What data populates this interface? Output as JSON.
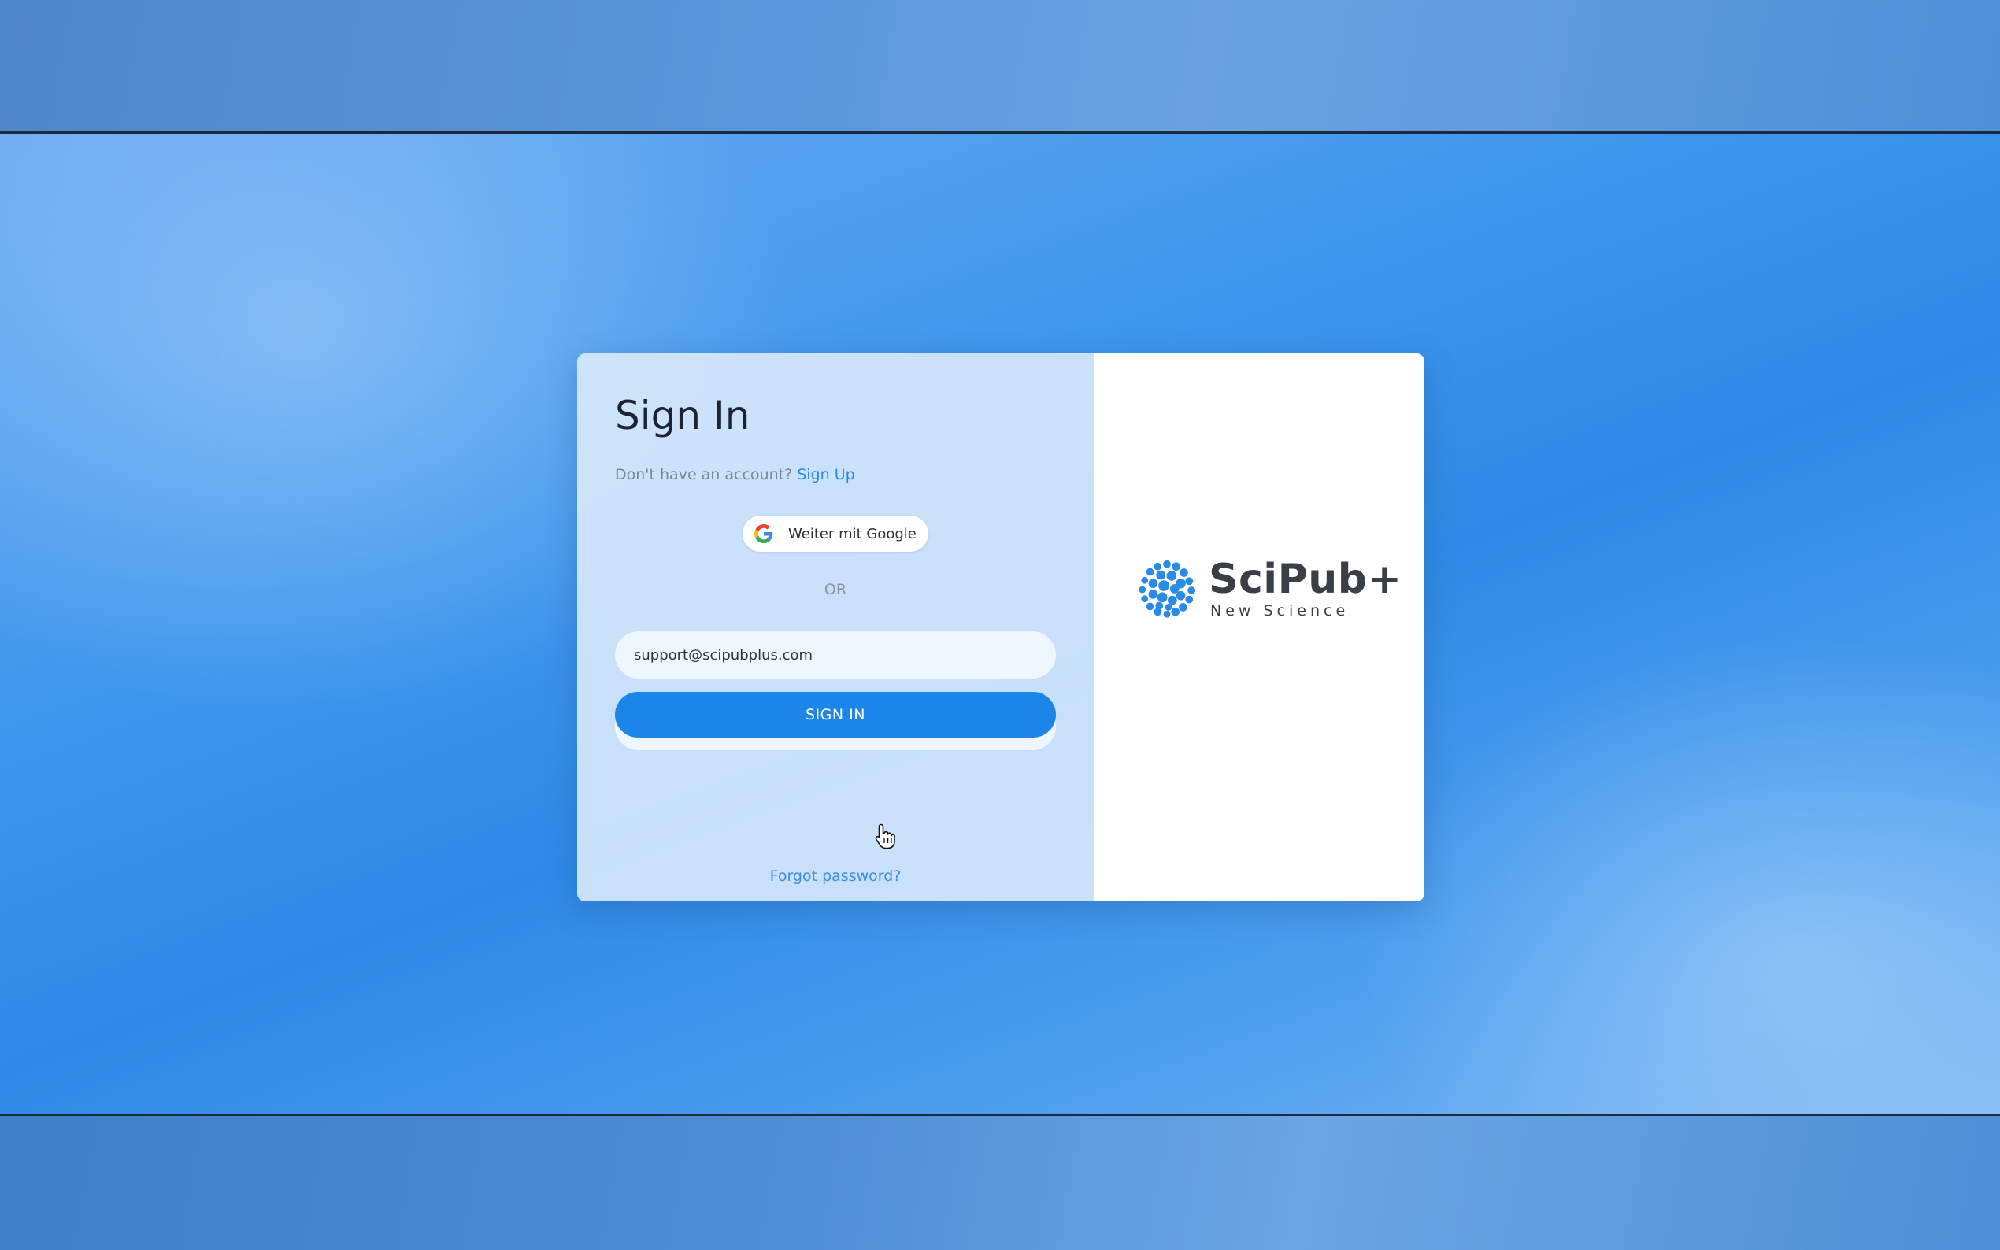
{
  "signin": {
    "title": "Sign In",
    "no_account_text": "Don't have an account?",
    "signup_link": "Sign Up",
    "google_button_label": "Weiter mit Google",
    "or_label": "OR",
    "email_value": "support@scipubplus.com",
    "password_masked": "•••••••••••••••",
    "submit_label": "SIGN IN",
    "forgot_password": "Forgot password?"
  },
  "brand": {
    "name": "SciPub+",
    "tagline": "New Science",
    "accent_color": "#1c86e8",
    "logo_color": "#2a8ae8"
  },
  "icons": {
    "google": "google-g-icon",
    "eye": "eye-icon",
    "cursor": "hand-pointer-icon"
  }
}
